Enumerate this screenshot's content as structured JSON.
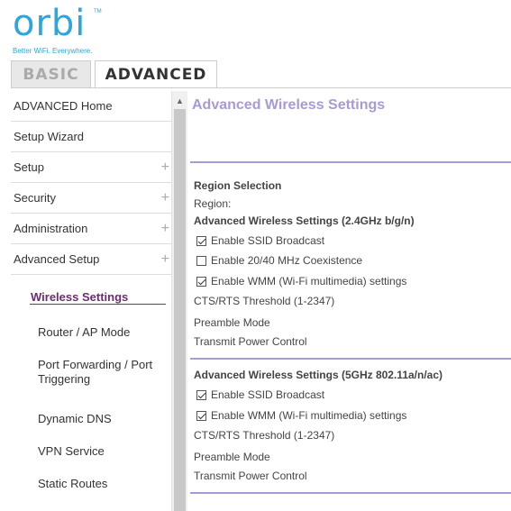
{
  "logo": {
    "word": "orbi",
    "tm": "TM",
    "tagline": "Better WiFi. Everywhere."
  },
  "tabs": [
    {
      "label": "BASIC"
    },
    {
      "label": "ADVANCED"
    }
  ],
  "sidebar": {
    "items": [
      {
        "label": "ADVANCED Home"
      },
      {
        "label": "Setup Wizard"
      },
      {
        "label": "Setup",
        "expand": "+"
      },
      {
        "label": "Security",
        "expand": "+"
      },
      {
        "label": "Administration",
        "expand": "+"
      },
      {
        "label": "Advanced Setup",
        "expand": "+"
      }
    ],
    "subitems": [
      {
        "label": "Wireless Settings"
      },
      {
        "label": "Router / AP Mode"
      },
      {
        "label": "Port Forwarding / Port Triggering"
      },
      {
        "label": "Dynamic DNS"
      },
      {
        "label": "VPN Service"
      },
      {
        "label": "Static Routes"
      }
    ]
  },
  "main": {
    "title": "Advanced Wireless Settings",
    "region_selection": "Region Selection",
    "region_label": "Region:",
    "section24": {
      "header": "Advanced Wireless Settings (2.4GHz b/g/n)",
      "ssid_broadcast": "Enable SSID Broadcast",
      "coexistence": "Enable 20/40 MHz Coexistence",
      "wmm": "Enable WMM (Wi-Fi multimedia) settings",
      "cts_rts": "CTS/RTS Threshold (1-2347)",
      "preamble": "Preamble Mode",
      "tx_power": "Transmit Power Control"
    },
    "section5": {
      "header": "Advanced Wireless Settings (5GHz 802.11a/n/ac)",
      "ssid_broadcast": "Enable SSID Broadcast",
      "wmm": "Enable WMM (Wi-Fi multimedia) settings",
      "cts_rts": "CTS/RTS Threshold (1-2347)",
      "preamble": "Preamble Mode",
      "tx_power": "Transmit Power Control"
    }
  },
  "colors": {
    "brand": "#2ba6de",
    "accent": "#a89ad8",
    "active": "#6d2c6e"
  }
}
